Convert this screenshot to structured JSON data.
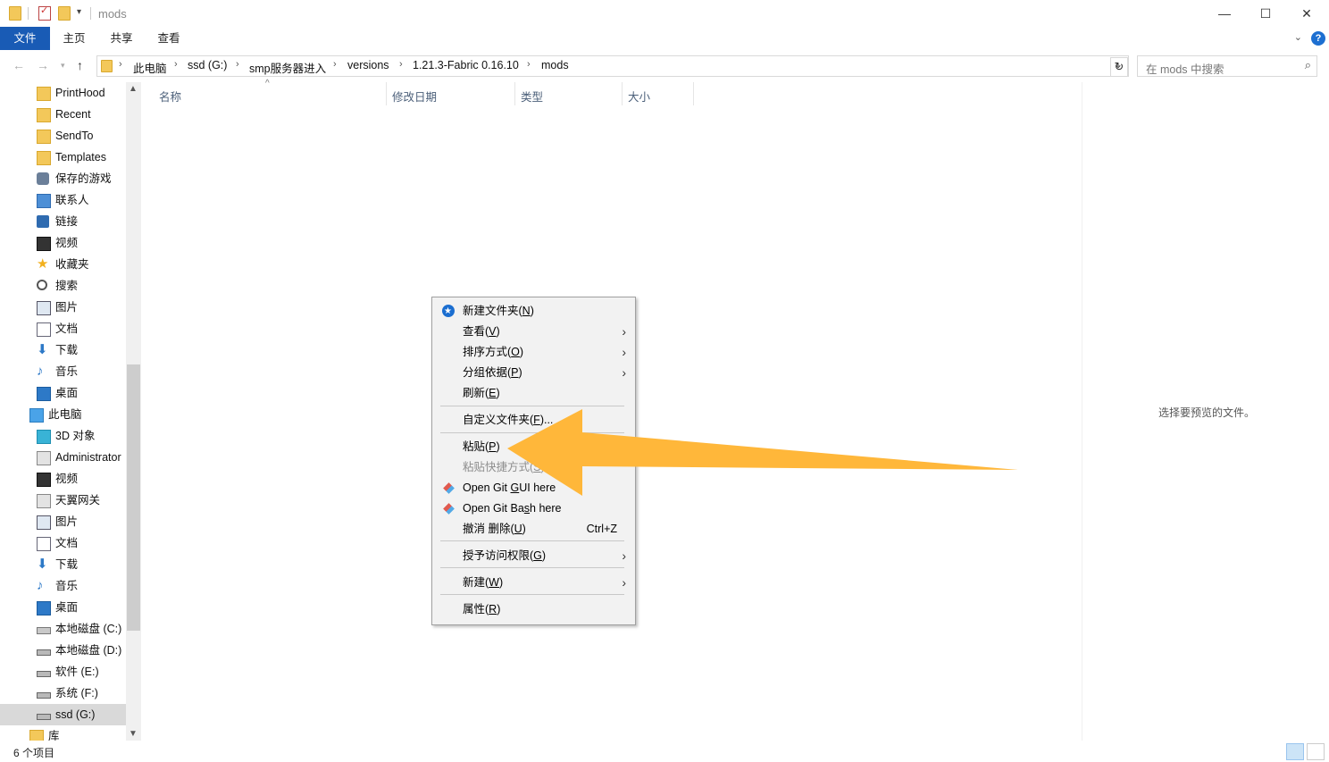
{
  "window": {
    "title": "mods",
    "controls": {
      "minimize": "—",
      "maximize": "☐",
      "close": "✕"
    }
  },
  "ribbon": {
    "tabs": [
      "文件",
      "主页",
      "共享",
      "查看"
    ],
    "help": "?",
    "collapse": "⌄"
  },
  "address": {
    "crumbs": [
      "此电脑",
      "ssd (G:)",
      "smp服务器进入",
      "versions",
      "1.21.3-Fabric 0.16.10",
      "mods"
    ],
    "dropdown": "⌄",
    "refresh": "↻"
  },
  "search": {
    "placeholder": "在 mods 中搜索",
    "icon": "search-icon"
  },
  "sidebar": {
    "items": [
      {
        "label": "PrintHood",
        "icon": "folder-icon"
      },
      {
        "label": "Recent",
        "icon": "folder-icon"
      },
      {
        "label": "SendTo",
        "icon": "folder-icon"
      },
      {
        "label": "Templates",
        "icon": "folder-icon"
      },
      {
        "label": "保存的游戏",
        "icon": "saved-games-icon"
      },
      {
        "label": "联系人",
        "icon": "contacts-icon"
      },
      {
        "label": "链接",
        "icon": "link-icon"
      },
      {
        "label": "视频",
        "icon": "video-icon"
      },
      {
        "label": "收藏夹",
        "icon": "star-icon"
      },
      {
        "label": "搜索",
        "icon": "search-icon"
      },
      {
        "label": "图片",
        "icon": "picture-icon"
      },
      {
        "label": "文档",
        "icon": "document-icon"
      },
      {
        "label": "下载",
        "icon": "download-icon"
      },
      {
        "label": "音乐",
        "icon": "music-icon"
      },
      {
        "label": "桌面",
        "icon": "desktop-icon"
      },
      {
        "label": "此电脑",
        "icon": "computer-icon"
      },
      {
        "label": "3D 对象",
        "icon": "cube-icon"
      },
      {
        "label": "Administrator",
        "icon": "user-folder-icon"
      },
      {
        "label": "视频",
        "icon": "video-icon"
      },
      {
        "label": "天翼网关",
        "icon": "network-folder-icon"
      },
      {
        "label": "图片",
        "icon": "picture-icon"
      },
      {
        "label": "文档",
        "icon": "document-icon"
      },
      {
        "label": "下载",
        "icon": "download-icon"
      },
      {
        "label": "音乐",
        "icon": "music-icon"
      },
      {
        "label": "桌面",
        "icon": "desktop-icon"
      },
      {
        "label": "本地磁盘 (C:)",
        "icon": "system-drive-icon"
      },
      {
        "label": "本地磁盘 (D:)",
        "icon": "drive-icon"
      },
      {
        "label": "软件 (E:)",
        "icon": "drive-icon"
      },
      {
        "label": "系统 (F:)",
        "icon": "drive-icon"
      },
      {
        "label": "ssd (G:)",
        "icon": "drive-icon"
      },
      {
        "label": "库",
        "icon": "library-icon"
      }
    ]
  },
  "columns": [
    "名称",
    "修改日期",
    "类型",
    "大小"
  ],
  "preview": {
    "text": "选择要预览的文件。"
  },
  "status": {
    "text": "6 个项目"
  },
  "context_menu": {
    "items": [
      {
        "pre": "新建文件夹(",
        "key": "N",
        "post": ")"
      },
      {
        "pre": "查看(",
        "key": "V",
        "post": ")"
      },
      {
        "pre": "排序方式(",
        "key": "O",
        "post": ")"
      },
      {
        "pre": "分组依据(",
        "key": "P",
        "post": ")"
      },
      {
        "pre": "刷新(",
        "key": "E",
        "post": ")"
      },
      {
        "pre": "自定义文件夹(",
        "key": "F",
        "post": ")..."
      },
      {
        "pre": "粘贴(",
        "key": "P",
        "post": ")"
      },
      {
        "pre": "粘贴快捷方式(",
        "key": "S",
        "post": ")"
      },
      {
        "pre": "Open Git ",
        "key": "G",
        "post": "UI here"
      },
      {
        "pre": "Open Git Ba",
        "key": "s",
        "post": "h here"
      },
      {
        "pre": "撤消 删除(",
        "key": "U",
        "post": ")",
        "shortcut": "Ctrl+Z"
      },
      {
        "pre": "授予访问权限(",
        "key": "G",
        "post": ")"
      },
      {
        "pre": "新建(",
        "key": "W",
        "post": ")"
      },
      {
        "pre": "属性(",
        "key": "R",
        "post": ")"
      }
    ],
    "chevron": "›"
  },
  "colors": {
    "ribbon_active": "#195bb5",
    "arrow": "#ffb73a",
    "sidebar_selected": "#d9d9d9"
  }
}
